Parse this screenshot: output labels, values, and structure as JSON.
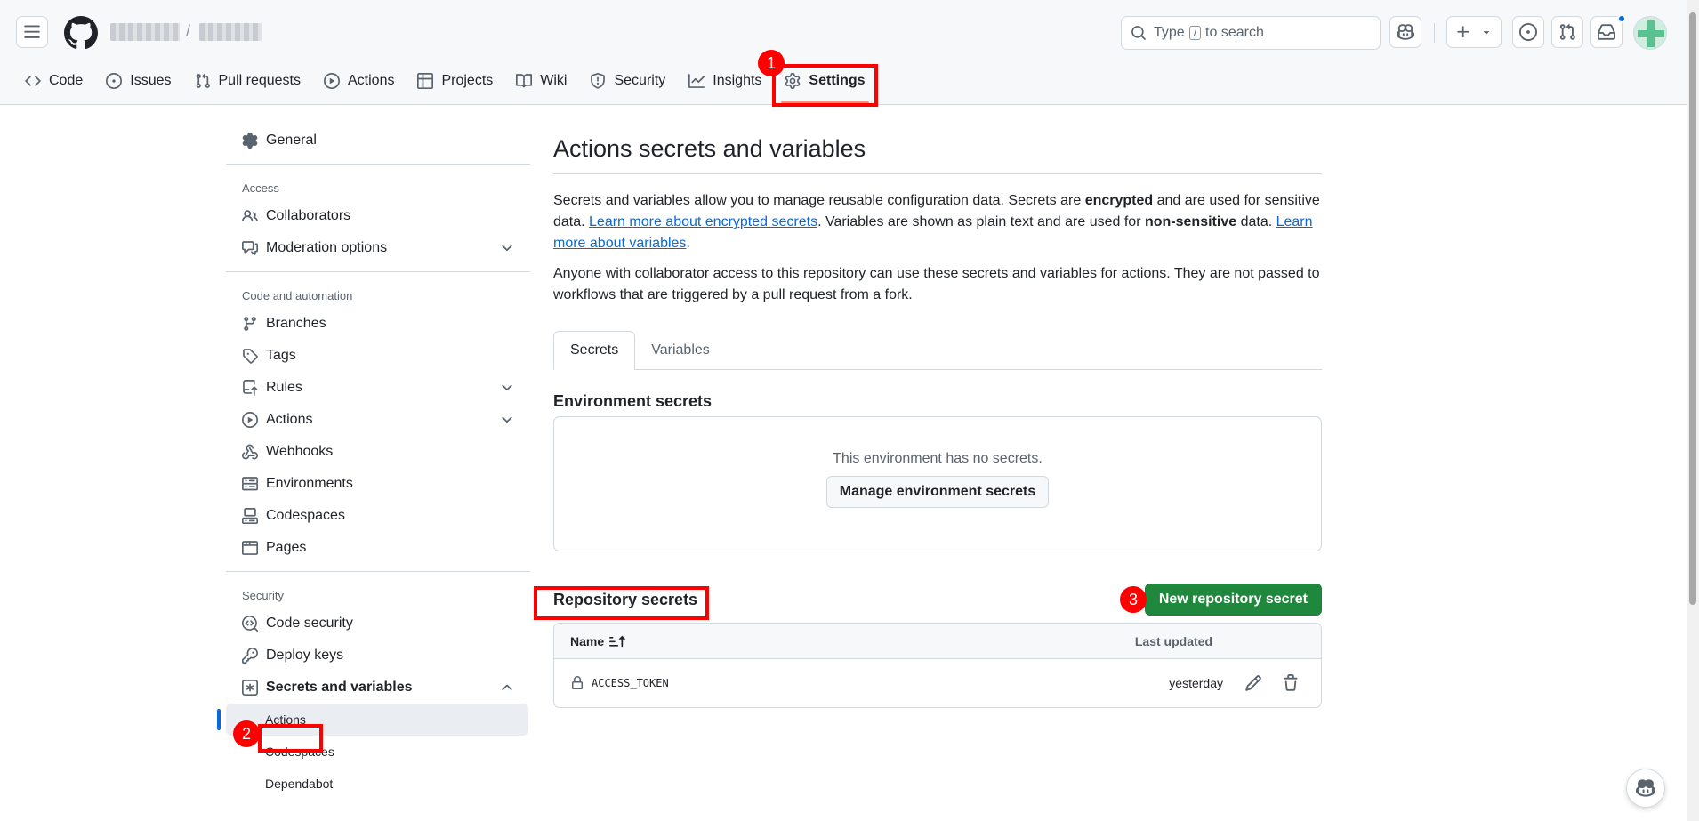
{
  "topbar": {
    "search_text_before": "Type",
    "search_key": "/",
    "search_text_after": "to search"
  },
  "repo_nav": [
    {
      "label": "Code",
      "icon": "code-icon"
    },
    {
      "label": "Issues",
      "icon": "issue-opened-icon"
    },
    {
      "label": "Pull requests",
      "icon": "pull-request-icon"
    },
    {
      "label": "Actions",
      "icon": "play-icon"
    },
    {
      "label": "Projects",
      "icon": "table-icon"
    },
    {
      "label": "Wiki",
      "icon": "book-icon"
    },
    {
      "label": "Security",
      "icon": "shield-icon"
    },
    {
      "label": "Insights",
      "icon": "graph-icon"
    },
    {
      "label": "Settings",
      "icon": "gear-icon",
      "selected": true
    }
  ],
  "sidebar": {
    "general": "General",
    "access_heading": "Access",
    "collaborators": "Collaborators",
    "moderation": "Moderation options",
    "code_heading": "Code and automation",
    "branches": "Branches",
    "tags": "Tags",
    "rules": "Rules",
    "actions": "Actions",
    "webhooks": "Webhooks",
    "environments": "Environments",
    "codespaces": "Codespaces",
    "pages": "Pages",
    "security_heading": "Security",
    "code_security": "Code security",
    "deploy_keys": "Deploy keys",
    "secrets_vars": "Secrets and variables",
    "sub_actions": "Actions",
    "sub_codespaces": "Codespaces",
    "sub_dependabot": "Dependabot"
  },
  "main": {
    "title": "Actions secrets and variables",
    "p1_a": "Secrets and variables allow you to manage reusable configuration data. Secrets are ",
    "p1_b": "encrypted",
    "p1_c": " and are used for sensitive data. ",
    "p1_link1": "Learn more about encrypted secrets",
    "p1_d": ". Variables are shown as plain text and are used for ",
    "p1_e": "non-sensitive",
    "p1_f": " data. ",
    "p1_link2": "Learn more about variables",
    "p1_g": ".",
    "p2": "Anyone with collaborator access to this repository can use these secrets and variables for actions. They are not passed to workflows that are triggered by a pull request from a fork.",
    "tab_secrets": "Secrets",
    "tab_variables": "Variables",
    "env_heading": "Environment secrets",
    "env_empty": "This environment has no secrets.",
    "env_button": "Manage environment secrets",
    "repo_heading": "Repository secrets",
    "new_secret_button": "New repository secret",
    "col_name": "Name",
    "col_updated": "Last updated",
    "secrets": [
      {
        "name": "ACCESS_TOKEN",
        "updated": "yesterday"
      }
    ]
  },
  "annotations": {
    "badge1": "1",
    "badge2": "2",
    "badge3": "3",
    "color": "#ff0000"
  }
}
